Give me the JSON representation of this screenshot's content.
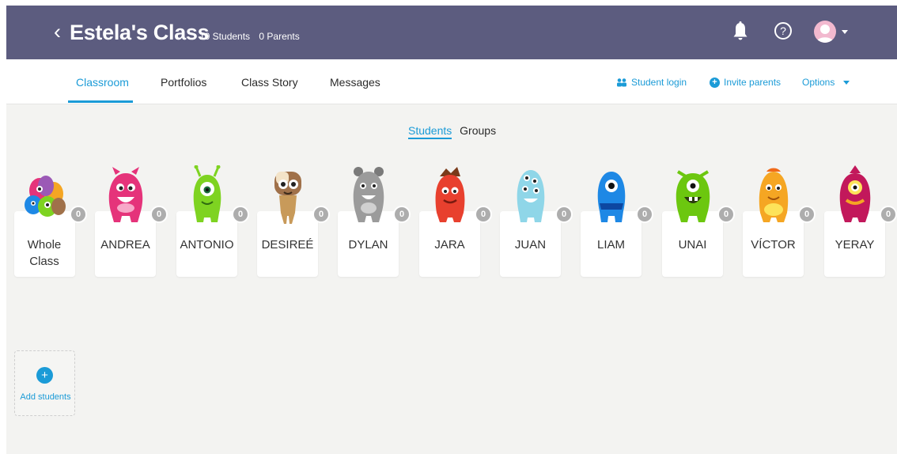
{
  "header": {
    "back_glyph": "‹",
    "class_name": "Estela's Class",
    "students_count": "10 Students",
    "parents_count": "0 Parents",
    "help_glyph": "?",
    "icons": [
      "back-arrow-icon",
      "bell-icon",
      "help-icon",
      "avatar-icon",
      "chevron-down-icon"
    ]
  },
  "nav": {
    "tabs": [
      "Classroom",
      "Portfolios",
      "Class Story",
      "Messages"
    ],
    "active_tab": "Classroom",
    "student_login": "Student login",
    "invite_parents": "Invite parents",
    "options": "Options"
  },
  "view_toggle": {
    "students": "Students",
    "groups": "Groups",
    "active": "Students"
  },
  "students": [
    {
      "name": "Whole Class",
      "points": "0",
      "monster": "group"
    },
    {
      "name": "ANDREA",
      "points": "0",
      "monster": "pink"
    },
    {
      "name": "ANTONIO",
      "points": "0",
      "monster": "lime"
    },
    {
      "name": "DESIREÉ",
      "points": "0",
      "monster": "brown"
    },
    {
      "name": "DYLAN",
      "points": "0",
      "monster": "gray"
    },
    {
      "name": "JARA",
      "points": "0",
      "monster": "red"
    },
    {
      "name": "JUAN",
      "points": "0",
      "monster": "lightblue"
    },
    {
      "name": "LIAM",
      "points": "0",
      "monster": "blue"
    },
    {
      "name": "UNAI",
      "points": "0",
      "monster": "green"
    },
    {
      "name": "VÍCTOR",
      "points": "0",
      "monster": "orange"
    },
    {
      "name": "YERAY",
      "points": "0",
      "monster": "magenta"
    }
  ],
  "add_students": {
    "label": "Add students",
    "glyph": "+"
  },
  "colors": {
    "header_bg": "#5c5c7f",
    "accent": "#1b9bd7",
    "page_bg": "#f3f3f1",
    "points_badge": "#adadad",
    "monsters": {
      "pink": "#e5337a",
      "lime": "#7ed321",
      "brown": "#a0714a",
      "gray": "#9b9b9b",
      "red": "#e8402e",
      "lightblue": "#8fd6e8",
      "blue": "#1e88e5",
      "green": "#6cc70f",
      "orange": "#f5a623",
      "magenta": "#c2185b"
    }
  }
}
